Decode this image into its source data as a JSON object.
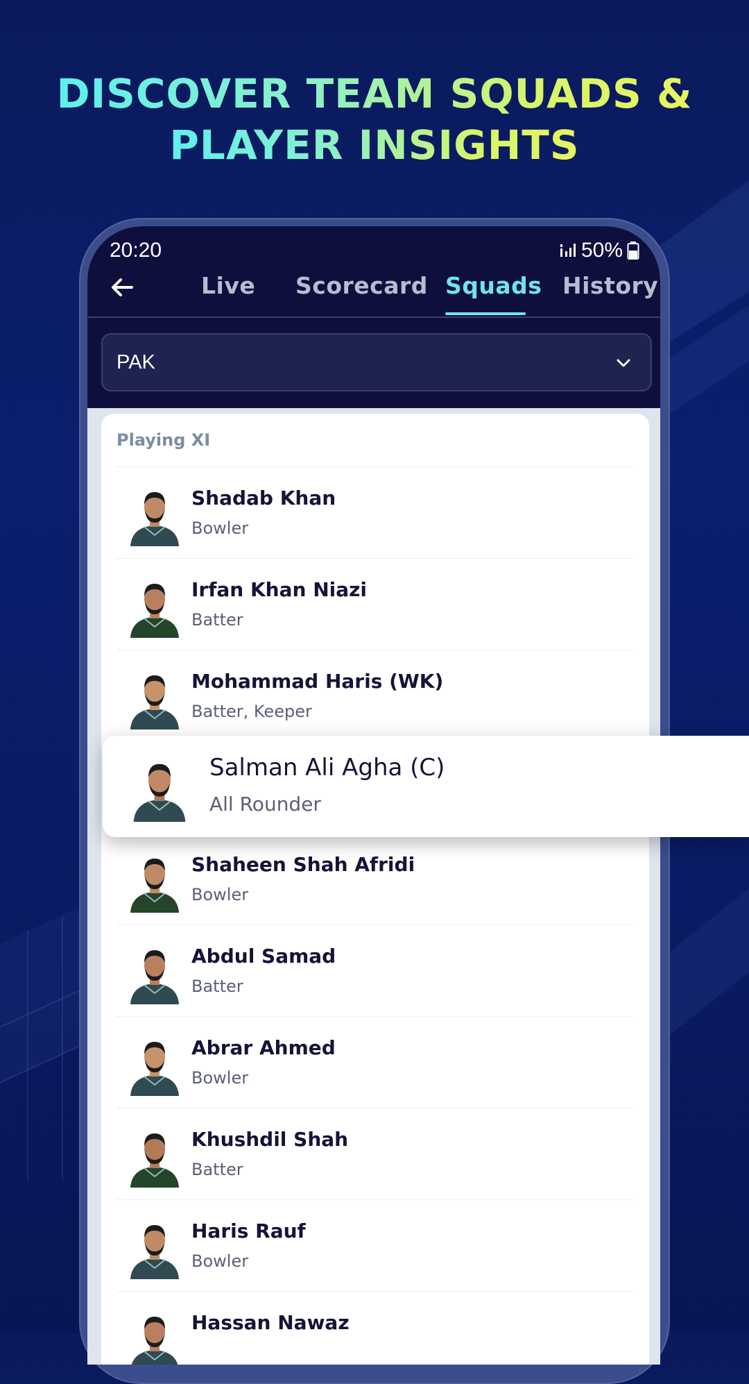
{
  "headline": {
    "line1": "DISCOVER TEAM SQUADS &",
    "line2": "PLAYER INSIGHTS"
  },
  "status_bar": {
    "time": "20:20",
    "battery": "50%"
  },
  "tabs": [
    {
      "label": "Live",
      "active": false
    },
    {
      "label": "Scorecard",
      "active": false
    },
    {
      "label": "Squads",
      "active": true
    },
    {
      "label": "History",
      "active": false
    }
  ],
  "team_select": {
    "value": "PAK"
  },
  "squad": {
    "section_title": "Playing XI",
    "players": [
      {
        "name": "Shadab Khan",
        "role": "Bowler"
      },
      {
        "name": "Irfan Khan Niazi",
        "role": "Batter"
      },
      {
        "name": "Mohammad Haris (WK)",
        "role": "Batter, Keeper"
      },
      {
        "name": "Salman Ali Agha (C)",
        "role": "All Rounder"
      },
      {
        "name": "Shaheen Shah Afridi",
        "role": "Bowler"
      },
      {
        "name": "Abdul Samad",
        "role": "Batter"
      },
      {
        "name": "Abrar Ahmed",
        "role": "Bowler"
      },
      {
        "name": "Khushdil Shah",
        "role": "Batter"
      },
      {
        "name": "Haris Rauf",
        "role": "Bowler"
      },
      {
        "name": "Hassan Nawaz",
        "role": ""
      }
    ],
    "highlighted_index": 3
  },
  "colors": {
    "accent": "#6fe3ee",
    "background": "#0b1f6e",
    "header": "#0f0f3d"
  }
}
